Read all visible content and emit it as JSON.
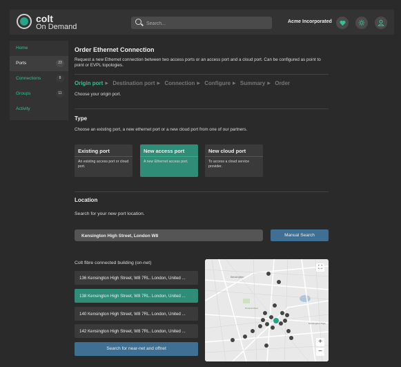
{
  "header": {
    "logo_name": "colt",
    "logo_sub": "On Demand",
    "search_placeholder": "Search...",
    "company": "Acme Incorporated",
    "icons": [
      "heart-icon",
      "sun-icon",
      "user-icon"
    ]
  },
  "sidebar": {
    "items": [
      {
        "label": "Home",
        "count": ""
      },
      {
        "label": "Ports",
        "count": "23"
      },
      {
        "label": "Connections",
        "count": "8"
      },
      {
        "label": "Groups",
        "count": "11"
      },
      {
        "label": "Activity",
        "count": ""
      }
    ]
  },
  "page": {
    "title": "Order Ethernet Connection",
    "description": "Request a new Ethernet connection between two access ports or an access port and a cloud port. Can be configured as point to point or EVPL topologies.",
    "steps": [
      "Origin port",
      "Destination port",
      "Connection",
      "Configure",
      "Summary",
      "Order"
    ],
    "step_note": "Choose your origin port."
  },
  "type": {
    "heading": "Type",
    "note": "Choose an existing port, a new ethernet port or a new cloud port from one of our partners.",
    "cards": [
      {
        "title": "Existing port",
        "desc": "An existing access port or cloud port."
      },
      {
        "title": "New access port",
        "desc": "A new Ethernet access port."
      },
      {
        "title": "New cloud port",
        "desc": "To access a cloud service provider."
      }
    ]
  },
  "location": {
    "heading": "Location",
    "note": "Search for your new port location.",
    "input_value": "Kensington High Street, London W8",
    "manual_search": "Manual Search",
    "buildings_label": "Colt fibre connected building (on-net)",
    "addresses": [
      "136 Kensington High Street, W8 7RL. London, United ...",
      "138 Kensington High Street, W8 7RL. London, United ...",
      "140 Kensington High Street, W8 7RL. London, United ...",
      "142 Kensington High Street, W8 7RL. London, United ..."
    ],
    "search_offnet": "Search for near-net and offnet"
  },
  "colors": {
    "accent": "#3bbf94",
    "selected": "#2e8c77",
    "button": "#3f6f93",
    "background": "#2a2a2a"
  }
}
